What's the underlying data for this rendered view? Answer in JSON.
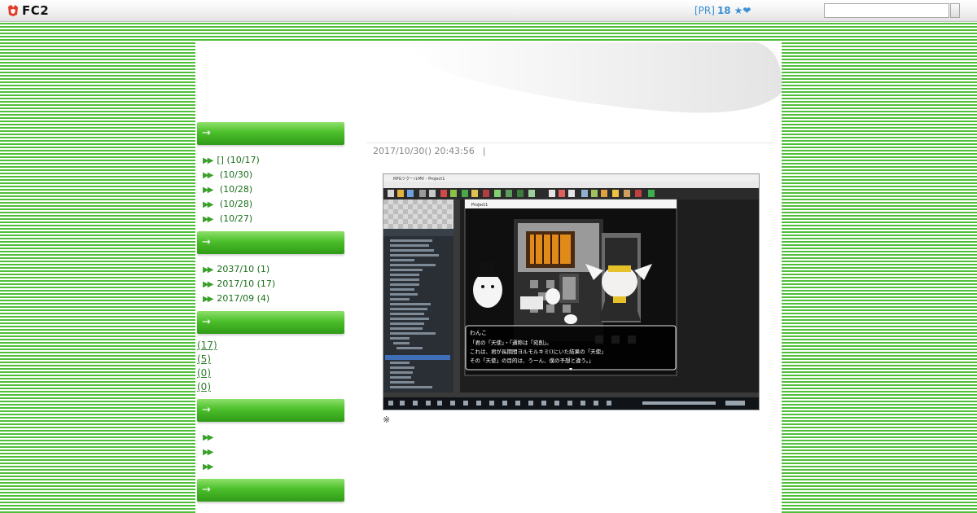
{
  "topbar": {
    "logo_text": "FC2",
    "pr_label": "[PR]",
    "pr_count": "18",
    "pr_icons": "★❤",
    "search": {
      "value": "",
      "placeholder": ""
    }
  },
  "sidebar": {
    "sections": [
      {
        "head_icon": "→",
        "items": [
          {
            "bullet": "▶▶",
            "text": "[] (10/17)"
          },
          {
            "bullet": "▶▶",
            "text": " (10/30)"
          },
          {
            "bullet": "▶▶",
            "text": " (10/28)"
          },
          {
            "bullet": "▶▶",
            "text": " (10/28)"
          },
          {
            "bullet": "▶▶",
            "text": " (10/27)"
          }
        ]
      },
      {
        "head_icon": "→",
        "items": [
          {
            "bullet": "▶▶",
            "text": "2037/10 (1)"
          },
          {
            "bullet": "▶▶",
            "text": "2017/10 (17)"
          },
          {
            "bullet": "▶▶",
            "text": "2017/09 (4)"
          }
        ]
      },
      {
        "head_icon": "→",
        "items": [
          {
            "text": "(17)"
          },
          {
            "text": "(5)"
          },
          {
            "text": "(0)"
          },
          {
            "text": "(0)"
          }
        ]
      },
      {
        "head_icon": "→",
        "items": [
          {
            "bullet": "▶▶",
            "text": ""
          },
          {
            "bullet": "▶▶",
            "text": ""
          },
          {
            "bullet": "▶▶",
            "text": ""
          }
        ]
      },
      {
        "head_icon": "→"
      }
    ]
  },
  "post": {
    "date": "2017/10/30() 20:43:56",
    "separator": "|",
    "note": "※",
    "screenshot": {
      "title": "RPGツクールMV - Project1",
      "game_title": "Project1",
      "speaker": "わんこ",
      "dialog": [
        "「君の「天使」・「通称は「宛削」。",
        " これは、君が長期間ヨルモルキミ()にいた結果の「天使」",
        "その「天使」の目的は、うーん、僕の予想と違う。」"
      ]
    }
  }
}
